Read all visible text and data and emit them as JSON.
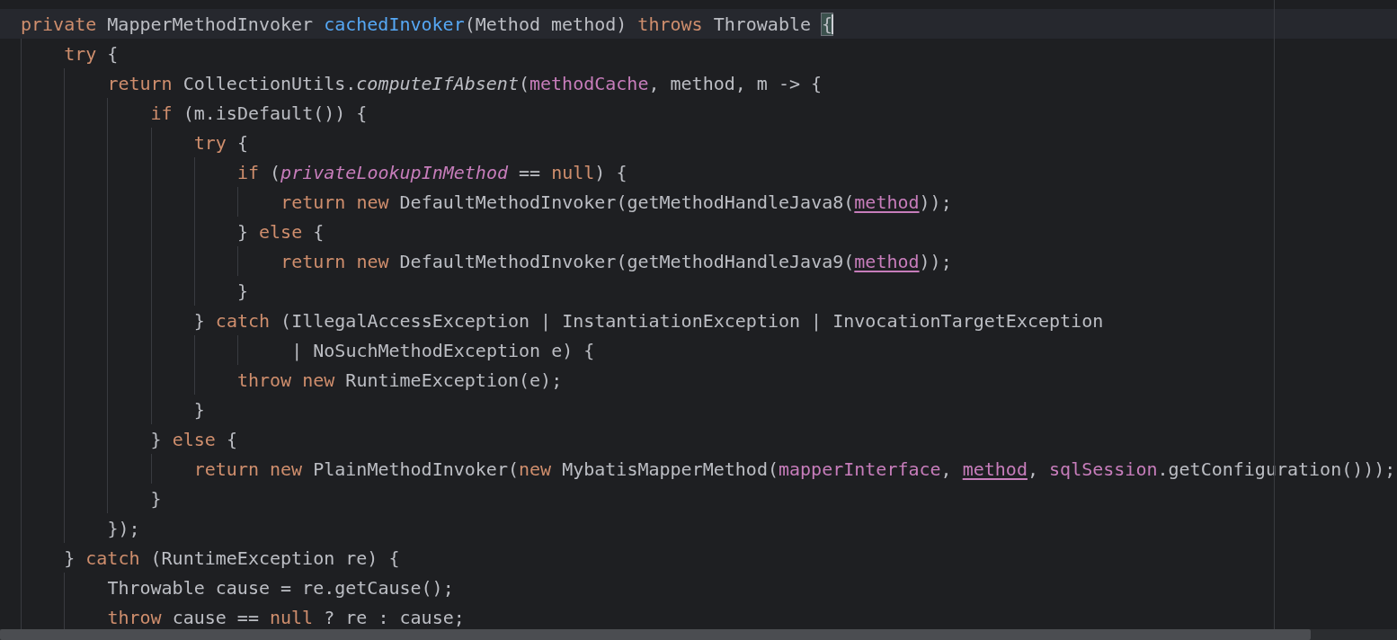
{
  "editor": {
    "lines": [
      {
        "current": true,
        "tokens": [
          {
            "kind": "kw",
            "text": "private "
          },
          {
            "kind": "plain",
            "text": "MapperMethodInvoker "
          },
          {
            "kind": "decl",
            "text": "cachedInvoker"
          },
          {
            "kind": "plain",
            "text": "(Method method) "
          },
          {
            "kind": "kw",
            "text": "throws "
          },
          {
            "kind": "plain",
            "text": "Throwable "
          },
          {
            "kind": "match",
            "text": "{"
          }
        ]
      },
      {
        "current": false,
        "tokens": [
          {
            "kind": "kw",
            "text": "    try "
          },
          {
            "kind": "plain",
            "text": "{"
          }
        ]
      },
      {
        "current": false,
        "tokens": [
          {
            "kind": "kw",
            "text": "        return "
          },
          {
            "kind": "plain",
            "text": "CollectionUtils."
          },
          {
            "kind": "static",
            "text": "computeIfAbsent"
          },
          {
            "kind": "plain",
            "text": "("
          },
          {
            "kind": "field",
            "text": "methodCache"
          },
          {
            "kind": "plain",
            "text": ", method, m -> {"
          }
        ]
      },
      {
        "current": false,
        "tokens": [
          {
            "kind": "kw",
            "text": "            if "
          },
          {
            "kind": "plain",
            "text": "(m.isDefault()) {"
          }
        ]
      },
      {
        "current": false,
        "tokens": [
          {
            "kind": "kw",
            "text": "                try "
          },
          {
            "kind": "plain",
            "text": "{"
          }
        ]
      },
      {
        "current": false,
        "tokens": [
          {
            "kind": "kw",
            "text": "                    if "
          },
          {
            "kind": "plain",
            "text": "("
          },
          {
            "kind": "static-field",
            "text": "privateLookupInMethod"
          },
          {
            "kind": "plain",
            "text": " == "
          },
          {
            "kind": "kw",
            "text": "null"
          },
          {
            "kind": "plain",
            "text": ") {"
          }
        ]
      },
      {
        "current": false,
        "tokens": [
          {
            "kind": "kw",
            "text": "                        return new "
          },
          {
            "kind": "plain",
            "text": "DefaultMethodInvoker(getMethodHandleJava8("
          },
          {
            "kind": "param",
            "text": "method"
          },
          {
            "kind": "plain",
            "text": "));"
          }
        ]
      },
      {
        "current": false,
        "tokens": [
          {
            "kind": "plain",
            "text": "                    } "
          },
          {
            "kind": "kw",
            "text": "else "
          },
          {
            "kind": "plain",
            "text": "{"
          }
        ]
      },
      {
        "current": false,
        "tokens": [
          {
            "kind": "kw",
            "text": "                        return new "
          },
          {
            "kind": "plain",
            "text": "DefaultMethodInvoker(getMethodHandleJava9("
          },
          {
            "kind": "param",
            "text": "method"
          },
          {
            "kind": "plain",
            "text": "));"
          }
        ]
      },
      {
        "current": false,
        "tokens": [
          {
            "kind": "plain",
            "text": "                    }"
          }
        ]
      },
      {
        "current": false,
        "tokens": [
          {
            "kind": "plain",
            "text": "                } "
          },
          {
            "kind": "kw",
            "text": "catch "
          },
          {
            "kind": "plain",
            "text": "(IllegalAccessException | InstantiationException | InvocationTargetException"
          }
        ]
      },
      {
        "current": false,
        "tokens": [
          {
            "kind": "plain",
            "text": "                         | NoSuchMethodException e) {"
          }
        ]
      },
      {
        "current": false,
        "tokens": [
          {
            "kind": "kw",
            "text": "                    throw new "
          },
          {
            "kind": "plain",
            "text": "RuntimeException(e);"
          }
        ]
      },
      {
        "current": false,
        "tokens": [
          {
            "kind": "plain",
            "text": "                }"
          }
        ]
      },
      {
        "current": false,
        "tokens": [
          {
            "kind": "plain",
            "text": "            } "
          },
          {
            "kind": "kw",
            "text": "else "
          },
          {
            "kind": "plain",
            "text": "{"
          }
        ]
      },
      {
        "current": false,
        "tokens": [
          {
            "kind": "kw",
            "text": "                return new "
          },
          {
            "kind": "plain",
            "text": "PlainMethodInvoker("
          },
          {
            "kind": "kw",
            "text": "new "
          },
          {
            "kind": "plain",
            "text": "MybatisMapperMethod("
          },
          {
            "kind": "field",
            "text": "mapperInterface"
          },
          {
            "kind": "plain",
            "text": ", "
          },
          {
            "kind": "param",
            "text": "method"
          },
          {
            "kind": "plain",
            "text": ", "
          },
          {
            "kind": "field",
            "text": "sqlSession"
          },
          {
            "kind": "plain",
            "text": ".getConfiguration()));"
          }
        ]
      },
      {
        "current": false,
        "tokens": [
          {
            "kind": "plain",
            "text": "            }"
          }
        ]
      },
      {
        "current": false,
        "tokens": [
          {
            "kind": "plain",
            "text": "        });"
          }
        ]
      },
      {
        "current": false,
        "tokens": [
          {
            "kind": "plain",
            "text": "    } "
          },
          {
            "kind": "kw",
            "text": "catch "
          },
          {
            "kind": "plain",
            "text": "(RuntimeException re) {"
          }
        ]
      },
      {
        "current": false,
        "tokens": [
          {
            "kind": "plain",
            "text": "        Throwable cause = re.getCause();"
          }
        ]
      },
      {
        "current": false,
        "tokens": [
          {
            "kind": "kw",
            "text": "        throw "
          },
          {
            "kind": "plain",
            "text": "cause == "
          },
          {
            "kind": "kw",
            "text": "null "
          },
          {
            "kind": "plain",
            "text": "? re : cause;"
          }
        ]
      }
    ]
  }
}
